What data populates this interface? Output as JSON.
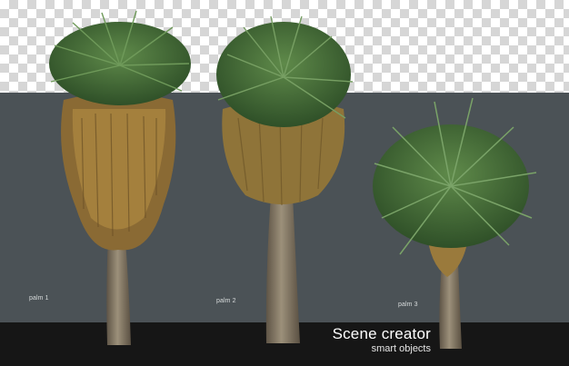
{
  "labels": {
    "palm1": "palm 1",
    "palm2": "palm 2",
    "palm3": "palm 3"
  },
  "brand": {
    "title": "Scene creator",
    "subtitle": "smart objects"
  },
  "colors": {
    "checker_light": "#ffffff",
    "checker_dark": "#d6d6d6",
    "backdrop": "#4b5256",
    "floor": "#161616",
    "frond_green": "#3f6b35",
    "frond_dark": "#2c4a26",
    "dry_frond": "#9a7a3c",
    "trunk": "#8a7d68"
  }
}
